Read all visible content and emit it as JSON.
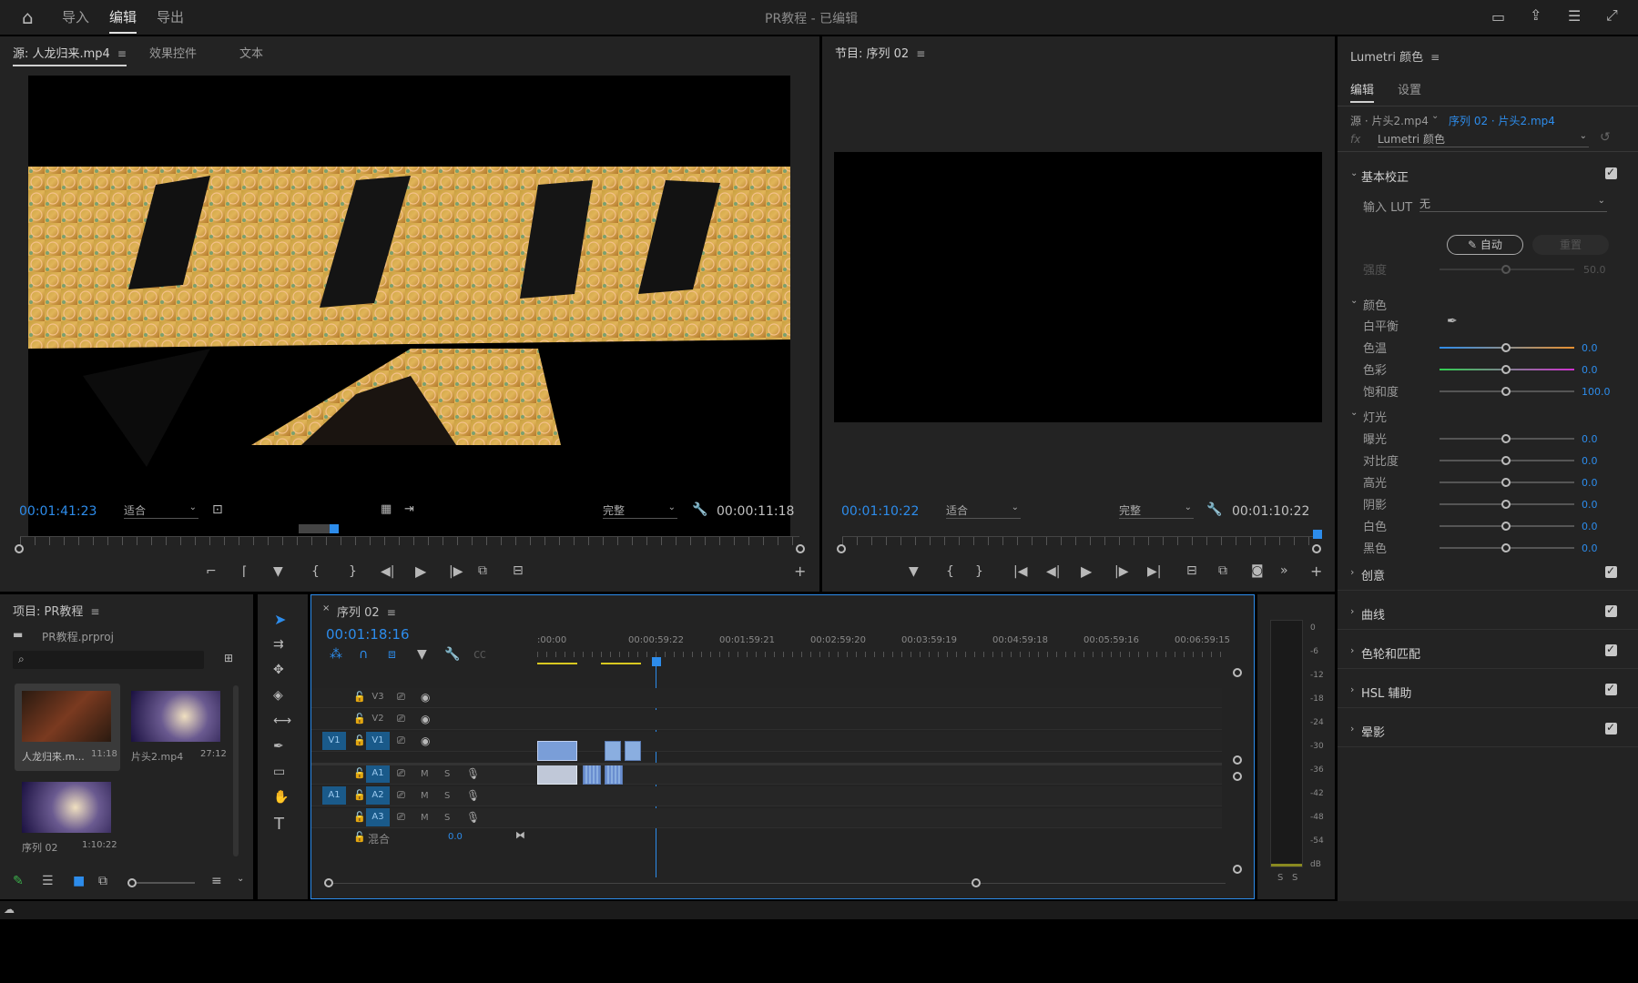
{
  "menu": {
    "home": "home-icon",
    "items": [
      "导入",
      "编辑",
      "导出"
    ],
    "active": "编辑",
    "title": "PR教程 - 已编辑"
  },
  "source_panel": {
    "tabs": [
      "源: 人龙归来.mp4",
      "效果控件",
      "文本"
    ],
    "timecode_in": "00:01:41:23",
    "fit": "适合",
    "quality": "完整",
    "duration": "00:00:11:18"
  },
  "program_panel": {
    "title": "节目: 序列 02",
    "timecode": "00:01:10:22",
    "fit": "适合",
    "quality": "完整",
    "duration": "00:01:10:22"
  },
  "project_panel": {
    "title": "项目: PR教程",
    "file": "PR教程.prproj",
    "search_placeholder": "",
    "items": [
      {
        "name": "人龙归来.m...",
        "duration": "11:18"
      },
      {
        "name": "片头2.mp4",
        "duration": "27:12"
      },
      {
        "name": "序列 02",
        "duration": "1:10:22"
      }
    ]
  },
  "timeline": {
    "title": "序列 02",
    "timecode": "00:01:18:16",
    "ruler": [
      ":00:00",
      "00:00:59:22",
      "00:01:59:21",
      "00:02:59:20",
      "00:03:59:19",
      "00:04:59:18",
      "00:05:59:16",
      "00:06:59:15"
    ],
    "video_tracks": [
      "V3",
      "V2",
      "V1"
    ],
    "audio_tracks": [
      "A1",
      "A2",
      "A3"
    ],
    "src_v": "V1",
    "src_a": "A1",
    "mix_label": "混合",
    "mix_value": "0.0",
    "m": "M",
    "s": "S"
  },
  "meter": {
    "labels": [
      "0",
      "-6",
      "-12",
      "-18",
      "-24",
      "-30",
      "-36",
      "-42",
      "-48",
      "-54",
      "dB"
    ],
    "solo": [
      "S",
      "S"
    ]
  },
  "lumetri": {
    "title": "Lumetri 颜色",
    "tabs": [
      "编辑",
      "设置"
    ],
    "source": "源 · 片头2.mp4",
    "sequence": "序列 02 · 片头2.mp4",
    "fx": "fx",
    "effect": "Lumetri 颜色",
    "basic": "基本校正",
    "lut_label": "输入 LUT",
    "lut_value": "无",
    "auto": "自动",
    "reset": "重置",
    "intensity_label": "强度",
    "intensity_value": "50.0",
    "color_section": "颜色",
    "wb_label": "白平衡",
    "color_rows": [
      {
        "label": "色温",
        "value": "0.0"
      },
      {
        "label": "色彩",
        "value": "0.0"
      },
      {
        "label": "饱和度",
        "value": "100.0"
      }
    ],
    "light_section": "灯光",
    "light_rows": [
      {
        "label": "曝光",
        "value": "0.0"
      },
      {
        "label": "对比度",
        "value": "0.0"
      },
      {
        "label": "高光",
        "value": "0.0"
      },
      {
        "label": "阴影",
        "value": "0.0"
      },
      {
        "label": "白色",
        "value": "0.0"
      },
      {
        "label": "黑色",
        "value": "0.0"
      }
    ],
    "sections": [
      "创意",
      "曲线",
      "色轮和匹配",
      "HSL 辅助",
      "晕影"
    ]
  },
  "colors": {
    "accent": "#2d8ceb",
    "panel_bg": "#232323",
    "app_bg": "#1b1b1b"
  }
}
